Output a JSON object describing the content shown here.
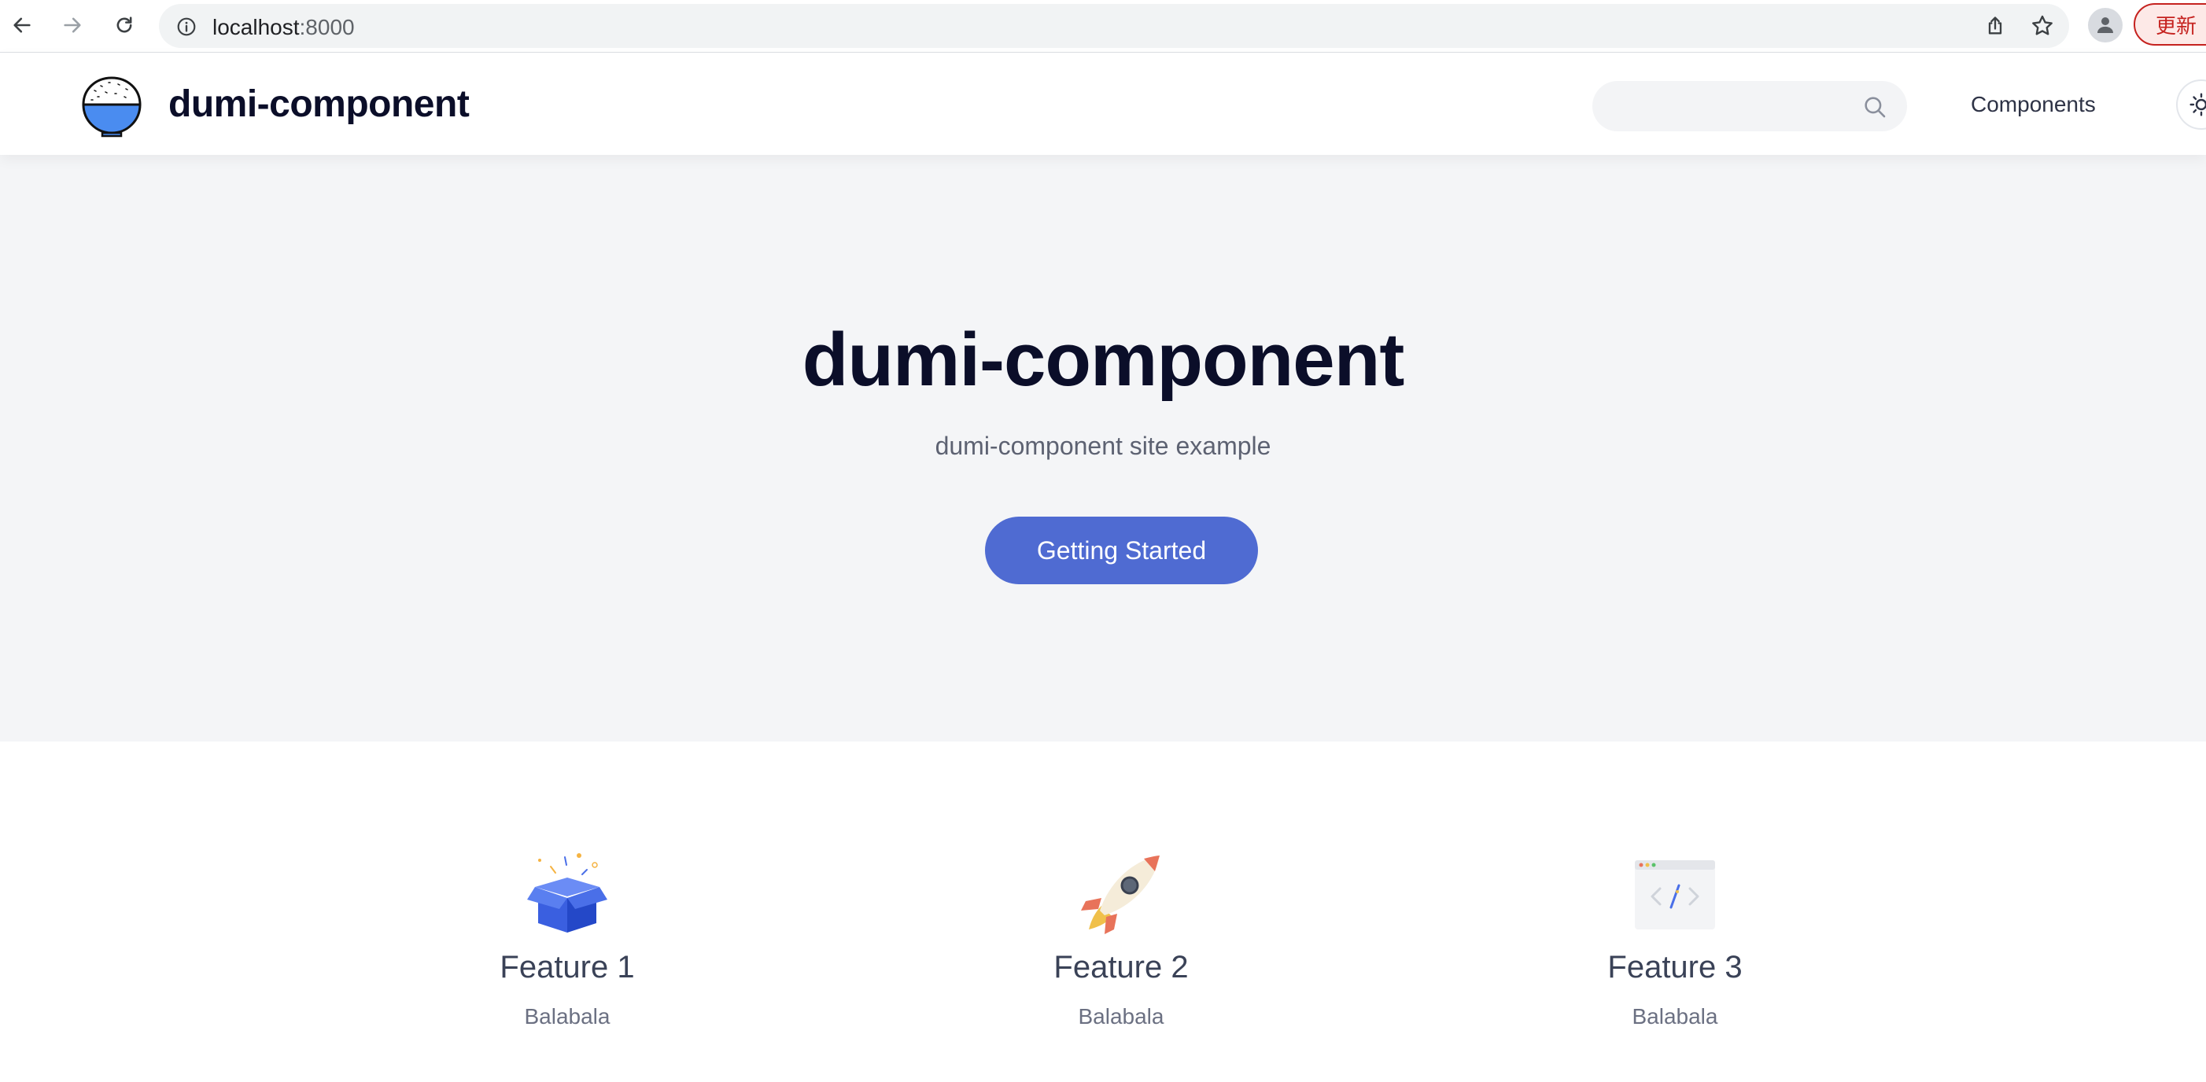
{
  "browser": {
    "url_host": "localhost",
    "url_port": ":8000",
    "update_label": "更新"
  },
  "header": {
    "site_title": "dumi-component",
    "search_placeholder": "",
    "nav_components": "Components"
  },
  "hero": {
    "title": "dumi-component",
    "description": "dumi-component site example",
    "cta_label": "Getting Started"
  },
  "features": [
    {
      "title": "Feature 1",
      "description": "Balabala",
      "icon": "gift-box-icon"
    },
    {
      "title": "Feature 2",
      "description": "Balabala",
      "icon": "rocket-icon"
    },
    {
      "title": "Feature 3",
      "description": "Balabala",
      "icon": "code-window-icon"
    }
  ],
  "colors": {
    "accent": "#4f6bd2",
    "hero_bg": "#f4f5f7",
    "title": "#0b0e29"
  }
}
